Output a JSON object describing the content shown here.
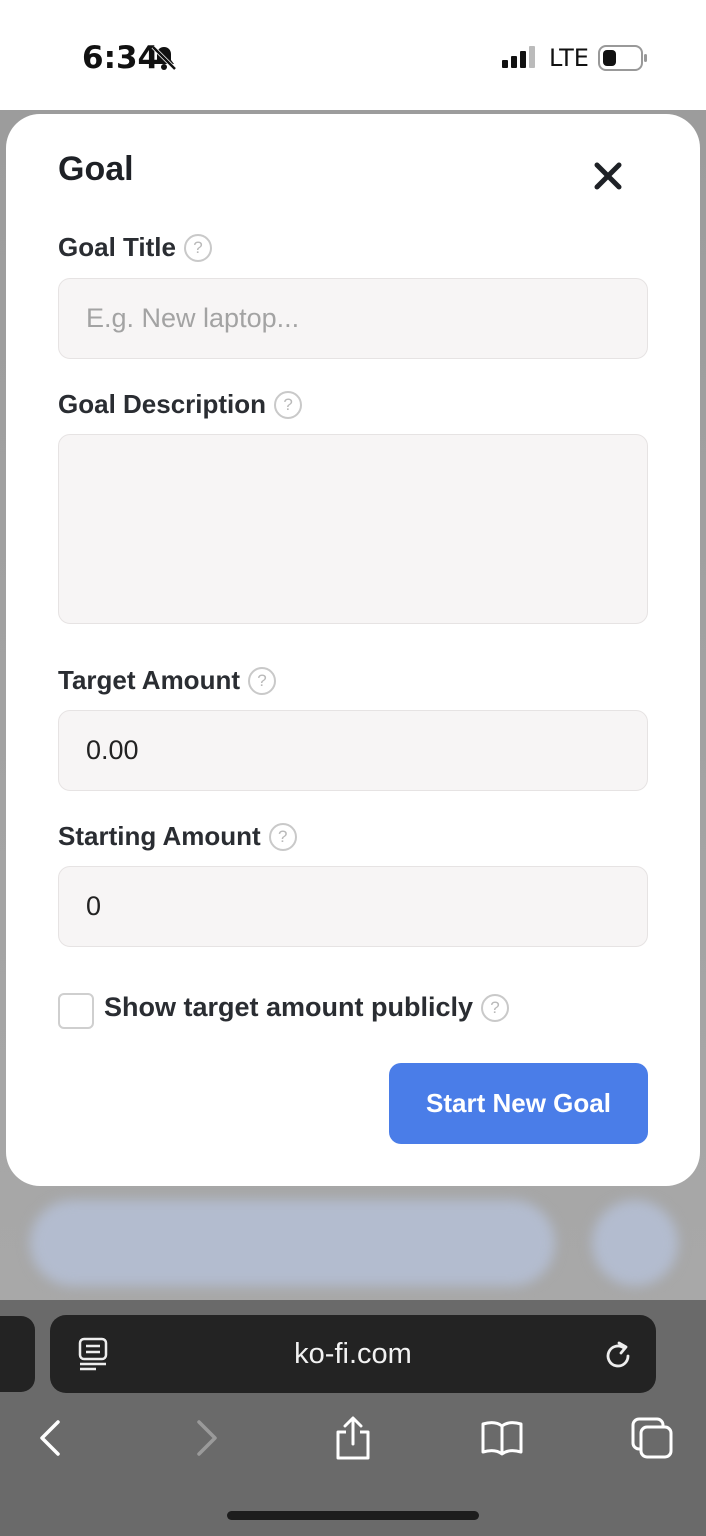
{
  "status_bar": {
    "time": "6:34",
    "network": "LTE"
  },
  "modal": {
    "title": "Goal",
    "goal_title": {
      "label": "Goal Title",
      "placeholder": "E.g. New laptop...",
      "value": ""
    },
    "goal_description": {
      "label": "Goal Description",
      "value": ""
    },
    "target_amount": {
      "label": "Target Amount",
      "value": "0.00"
    },
    "starting_amount": {
      "label": "Starting Amount",
      "value": "0"
    },
    "show_publicly": {
      "label": "Show target amount publicly",
      "checked": false
    },
    "submit_label": "Start New Goal",
    "help_glyph": "?"
  },
  "browser": {
    "url": "ko-fi.com"
  },
  "icons": {
    "close": "close-icon",
    "help": "question-circle-icon",
    "reader": "reader-mode-icon",
    "reload": "reload-icon",
    "back": "chevron-left-icon",
    "forward": "chevron-right-icon",
    "share": "share-icon",
    "bookmarks": "book-icon",
    "tabs": "tabs-icon"
  },
  "colors": {
    "primary_button": "#4a7de8",
    "modal_bg": "#ffffff",
    "input_bg": "#f7f5f5"
  }
}
